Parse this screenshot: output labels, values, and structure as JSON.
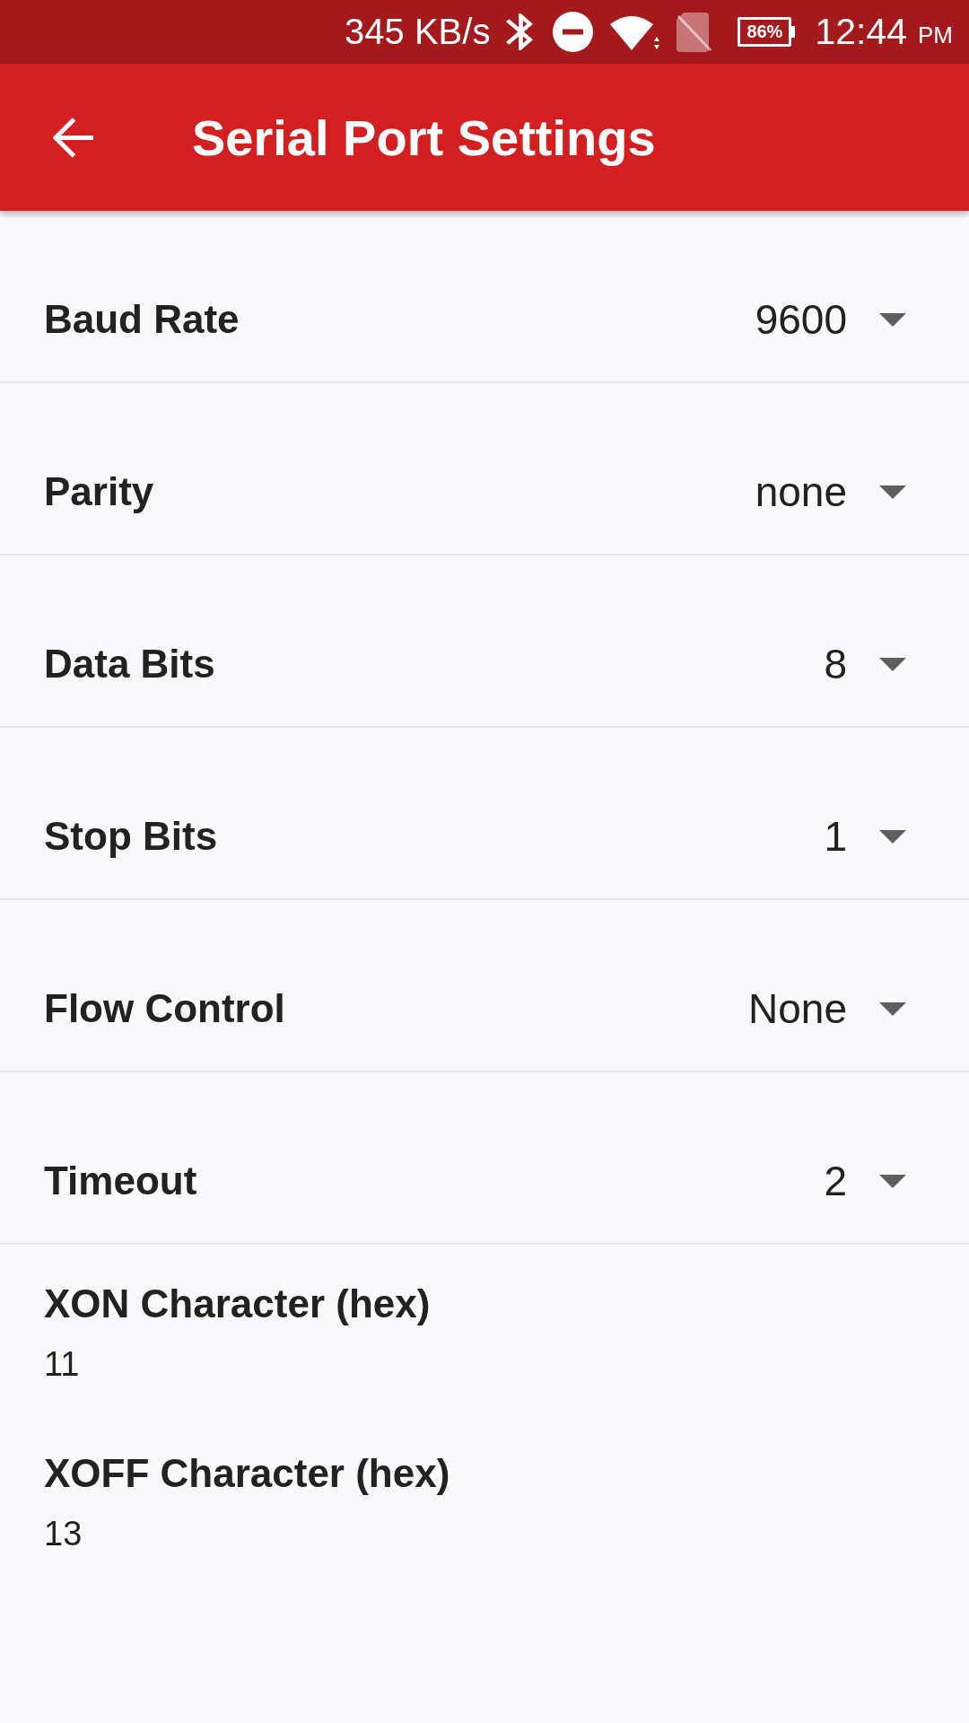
{
  "status_bar": {
    "network_speed": "345 KB/s",
    "battery": "86%",
    "time": "12:44",
    "time_suffix": "PM"
  },
  "app_bar": {
    "title": "Serial Port Settings"
  },
  "settings": [
    {
      "kind": "dropdown",
      "label": "Baud Rate",
      "value": "9600"
    },
    {
      "kind": "dropdown",
      "label": "Parity",
      "value": "none"
    },
    {
      "kind": "dropdown",
      "label": "Data Bits",
      "value": "8"
    },
    {
      "kind": "dropdown",
      "label": "Stop Bits",
      "value": "1"
    },
    {
      "kind": "dropdown",
      "label": "Flow Control",
      "value": "None"
    },
    {
      "kind": "dropdown",
      "label": "Timeout",
      "value": "2"
    },
    {
      "kind": "text",
      "label": "XON Character (hex)",
      "value": "11"
    },
    {
      "kind": "text",
      "label": "XOFF Character (hex)",
      "value": "13"
    }
  ]
}
